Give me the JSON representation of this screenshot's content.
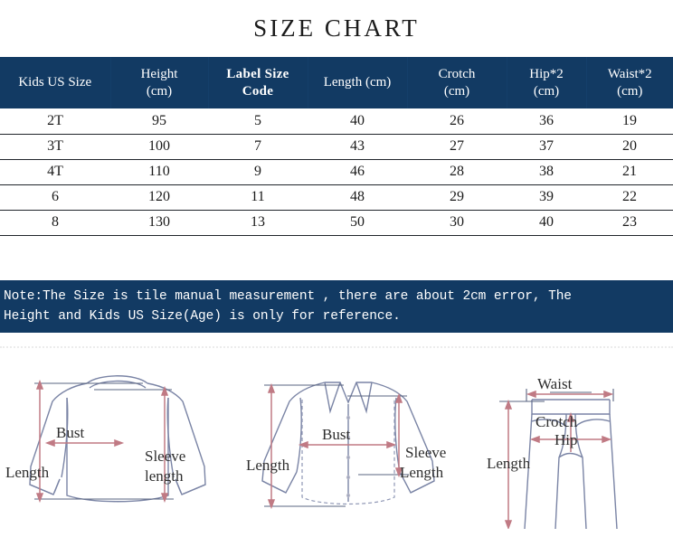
{
  "title": "SIZE CHART",
  "colors": {
    "band": "#123A63",
    "band_text": "#ffffff",
    "row_text": "#1a1a1a",
    "garment_stroke": "#7a84a5",
    "measure_arrow": "#c07a84",
    "guide_line": "#5a6480",
    "label_text": "#2e2e2e",
    "dotted_separator": "#ececec"
  },
  "table": {
    "headers": [
      {
        "label": "Kids US Size",
        "bold": false
      },
      {
        "label": "Height\n(cm)",
        "bold": false
      },
      {
        "label": "Label Size\nCode",
        "bold": true
      },
      {
        "label": "Length  (cm)",
        "bold": false
      },
      {
        "label": "Crotch\n(cm)",
        "bold": false
      },
      {
        "label": "Hip*2\n(cm)",
        "bold": false
      },
      {
        "label": "Waist*2\n(cm)",
        "bold": false
      }
    ],
    "rows": [
      {
        "kids_us_size": "2T",
        "height_cm": "95",
        "label_size_code": "5",
        "length_cm": "40",
        "crotch_cm": "26",
        "hip_x2_cm": "36",
        "waist_x2_cm": "19"
      },
      {
        "kids_us_size": "3T",
        "height_cm": "100",
        "label_size_code": "7",
        "length_cm": "43",
        "crotch_cm": "27",
        "hip_x2_cm": "37",
        "waist_x2_cm": "20"
      },
      {
        "kids_us_size": "4T",
        "height_cm": "110",
        "label_size_code": "9",
        "length_cm": "46",
        "crotch_cm": "28",
        "hip_x2_cm": "38",
        "waist_x2_cm": "21"
      },
      {
        "kids_us_size": "6",
        "height_cm": "120",
        "label_size_code": "11",
        "length_cm": "48",
        "crotch_cm": "29",
        "hip_x2_cm": "39",
        "waist_x2_cm": "22"
      },
      {
        "kids_us_size": "8",
        "height_cm": "130",
        "label_size_code": "13",
        "length_cm": "50",
        "crotch_cm": "30",
        "hip_x2_cm": "40",
        "waist_x2_cm": "23"
      }
    ]
  },
  "note": "Note:The Size is tile manual measurement , there are about 2cm error, The\nHeight and Kids US Size(Age) is only for reference.",
  "diagrams": [
    {
      "garment": "sweater",
      "labels": {
        "length": "Length",
        "bust": "Bust",
        "sleeve_line1": "Sleeve",
        "sleeve_line2": "length"
      }
    },
    {
      "garment": "shirt",
      "labels": {
        "length": "Length",
        "bust": "Bust",
        "sleeve_line1": "Sleeve",
        "sleeve_line2": "Length"
      }
    },
    {
      "garment": "pants",
      "labels": {
        "length": "Length",
        "waist": "Waist",
        "crotch": "Crotch",
        "hip": "Hip"
      }
    }
  ]
}
